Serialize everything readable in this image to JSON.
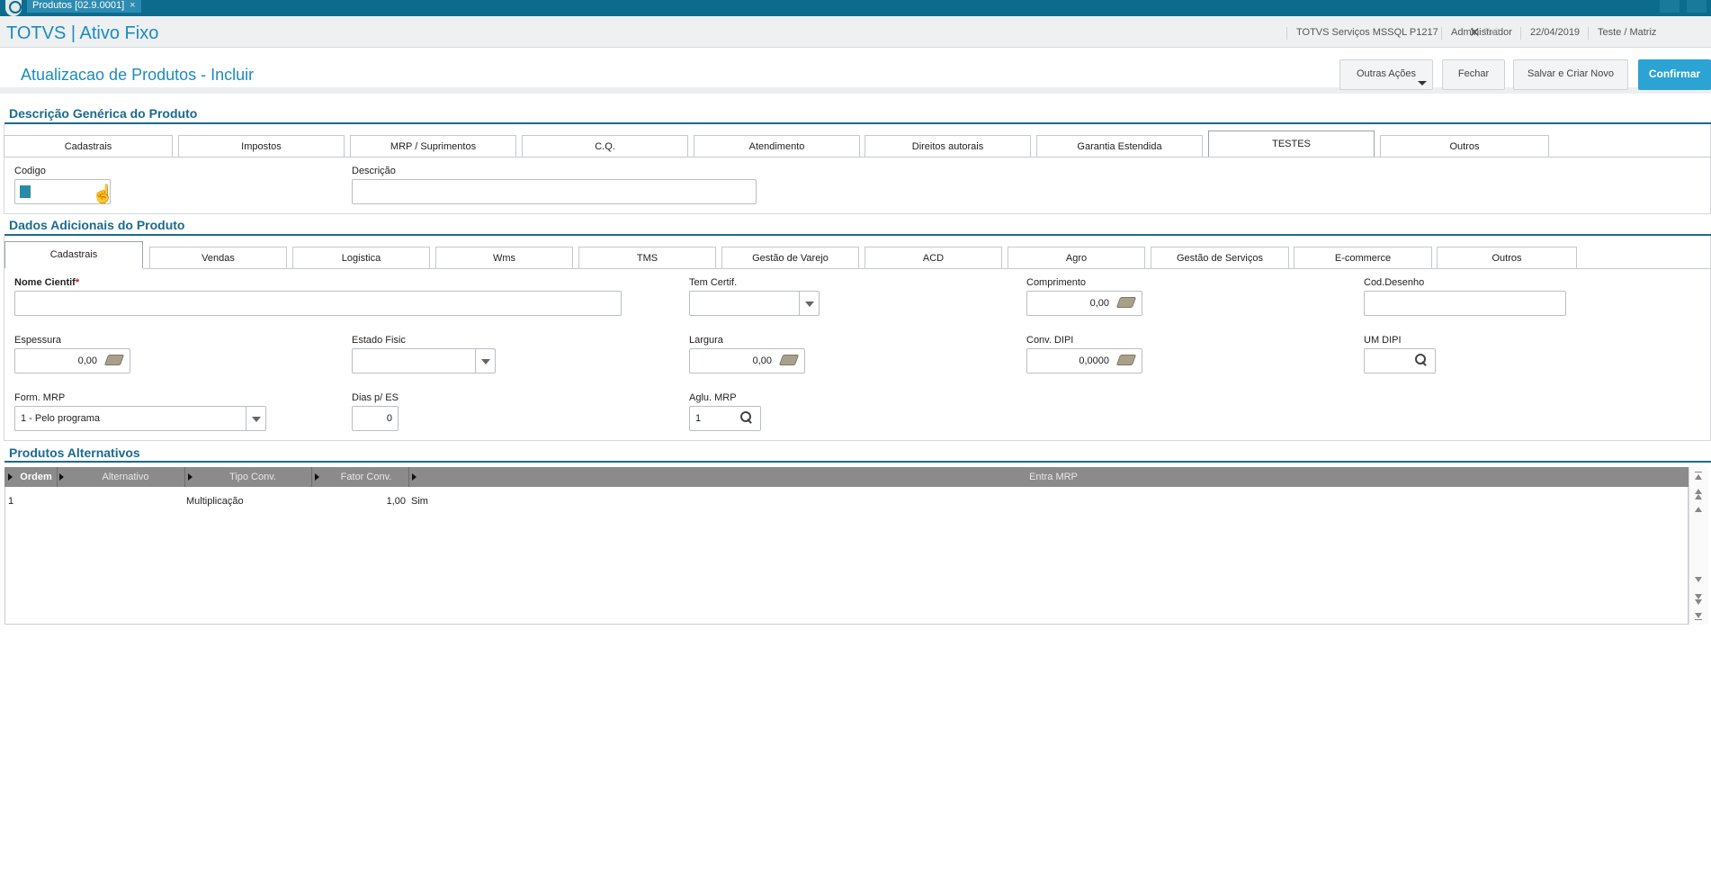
{
  "topbar": {
    "doc_tab_label": "Produtos [02.9.0001]",
    "doc_tab_close": "×"
  },
  "header": {
    "app_title": "TOTVS | Ativo Fixo",
    "info": [
      "TOTVS Serviços MSSQL P1217",
      "Administrador",
      "22/04/2019",
      "Teste / Matriz"
    ],
    "exit_label": "Exit",
    "exit_icon": "✕"
  },
  "page": {
    "title": "Atualizacao de Produtos - Incluir"
  },
  "actions": {
    "other_actions": "Outras Ações",
    "close": "Fechar",
    "save_new": "Salvar e Criar Novo",
    "confirm": "Confirmar"
  },
  "section1": {
    "title": "Descrição Genérica do Produto",
    "tabs": [
      "Cadastrais",
      "Impostos",
      "MRP / Suprimentos",
      "C.Q.",
      "Atendimento",
      "Direitos autorais",
      "Garantia Estendida",
      "TESTES",
      "Outros"
    ],
    "active_tab": "TESTES",
    "fields": {
      "codigo_label": "Codigo",
      "codigo_value": "",
      "descricao_label": "Descrição",
      "descricao_value": ""
    }
  },
  "section2": {
    "title": "Dados Adicionais do Produto",
    "tabs": [
      "Cadastrais",
      "Vendas",
      "Logistica",
      "Wms",
      "TMS",
      "Gestão de Varejo",
      "ACD",
      "Agro",
      "Gestão de Serviços",
      "E-commerce",
      "Outros"
    ],
    "active_tab": "Cadastrais",
    "fields": {
      "nome_cientif_label": "Nome Cientif",
      "nome_cientif_required": "*",
      "nome_cientif_value": "",
      "tem_certif_label": "Tem Certif.",
      "tem_certif_value": "",
      "comprimento_label": "Comprimento",
      "comprimento_value": "0,00",
      "cod_desenho_label": "Cod.Desenho",
      "cod_desenho_value": "",
      "espessura_label": "Espessura",
      "espessura_value": "0,00",
      "estado_fisic_label": "Estado Fisic",
      "estado_fisic_value": "",
      "largura_label": "Largura",
      "largura_value": "0,00",
      "conv_dipi_label": "Conv. DIPI",
      "conv_dipi_value": "0,0000",
      "um_dipi_label": "UM DIPI",
      "um_dipi_value": "",
      "form_mrp_label": "Form. MRP",
      "form_mrp_value": "1 - Pelo programa",
      "dias_es_label": "Dias p/ ES",
      "dias_es_value": "0",
      "aglu_mrp_label": "Aglu. MRP",
      "aglu_mrp_value": "1"
    }
  },
  "section3": {
    "title": "Produtos Alternativos",
    "columns": [
      "Ordem",
      "Alternativo",
      "Tipo Conv.",
      "Fator Conv.",
      "Entra MRP"
    ],
    "rows": [
      {
        "ordem": "1",
        "alternativo": "",
        "tipo_conv": "Multiplicação",
        "fator_conv": "1,00",
        "entra_mrp": "Sim"
      }
    ]
  },
  "colors": {
    "topbar": "#0d6b8d",
    "accent": "#1b8cbd",
    "section": "#1b6a8f",
    "confirm": "#2ba3d3",
    "grid_header": "#8b8b8b"
  },
  "icons": {
    "logo": "totvs-logo-icon",
    "calculator": "calculator-icon",
    "search": "search-icon",
    "dropdown": "chevron-down-icon",
    "cursor": "hand-cursor-icon"
  }
}
